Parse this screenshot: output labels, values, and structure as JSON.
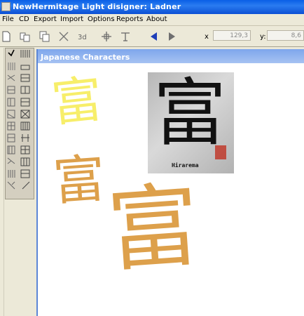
{
  "window": {
    "title": "NewHermitage Light   disigner: Ladner"
  },
  "menu": {
    "items": [
      "File",
      "CD",
      "Export",
      "Import",
      "Options",
      "Reports",
      "About"
    ]
  },
  "toolbar": {
    "x_label": "x",
    "x_value": "129,3",
    "y_label": "y:",
    "y_value": "8,6"
  },
  "document": {
    "title": "Japanese Characters",
    "character": "富",
    "photo_signature": "Hirarema",
    "colors": {
      "yellow_kanji": "#f7ee6a",
      "orange_kanji": "#d8902c",
      "ink": "#111111",
      "seal": "#c0392b"
    }
  }
}
